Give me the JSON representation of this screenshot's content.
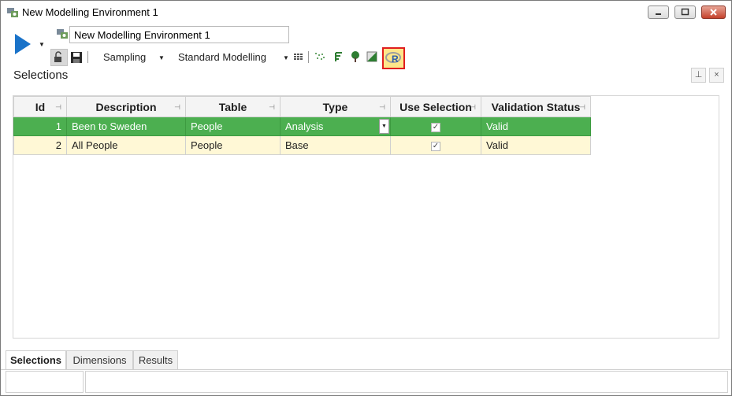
{
  "window": {
    "title": "New Modelling Environment 1",
    "icon": "modelling-environment-icon"
  },
  "toolbar": {
    "environment_name": "New Modelling Environment 1",
    "sampling_label": "Sampling",
    "modelling_label": "Standard Modelling",
    "icons": [
      "play-icon",
      "lock-icon",
      "save-icon",
      "grid-icon",
      "scatter-icon",
      "formula-icon",
      "tree-icon",
      "gradient-icon",
      "r-script-icon"
    ]
  },
  "pane": {
    "title": "Selections",
    "pin_glyph": "⊥",
    "close_glyph": "×"
  },
  "grid": {
    "columns": [
      "Id",
      "Description",
      "Table",
      "Type",
      "Use Selection",
      "Validation Status"
    ],
    "rows": [
      {
        "id": "1",
        "description": "Been to Sweden",
        "table": "People",
        "type": "Analysis",
        "use_selection": true,
        "status": "Valid"
      },
      {
        "id": "2",
        "description": "All People",
        "table": "People",
        "type": "Base",
        "use_selection": true,
        "status": "Valid"
      }
    ]
  },
  "tabs": [
    "Selections",
    "Dimensions",
    "Results"
  ],
  "active_tab": "Selections",
  "colors": {
    "selected_row": "#4caf50",
    "alt_row": "#fff8d6",
    "highlight_border": "#e01e1e",
    "play": "#1a73c9"
  }
}
